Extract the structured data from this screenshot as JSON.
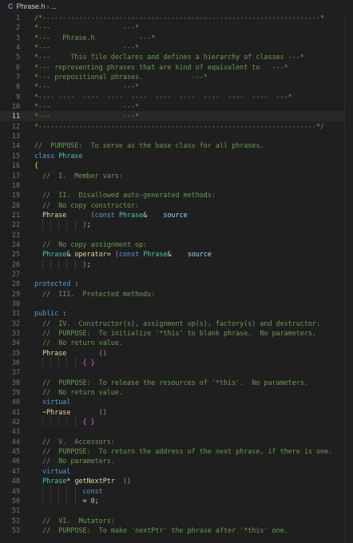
{
  "breadcrumb": {
    "file_icon": "C",
    "file_name": "Phrase.h",
    "separator": "›",
    "more": "..."
  },
  "editor": {
    "current_line": 11,
    "lines": [
      {
        "num": "1",
        "segs": [
          [
            "c",
            "/*---------------------------------------------------------------------*"
          ]
        ]
      },
      {
        "num": "2",
        "segs": [
          [
            "c",
            "*---                  ---*"
          ]
        ]
      },
      {
        "num": "3",
        "segs": [
          [
            "c",
            "*---   Phrase.h           ---*"
          ]
        ]
      },
      {
        "num": "4",
        "segs": [
          [
            "c",
            "*---                  ---*"
          ]
        ]
      },
      {
        "num": "5",
        "segs": [
          [
            "c",
            "*---     This file declares and defines a hierarchy of classes ---*"
          ]
        ]
      },
      {
        "num": "6",
        "segs": [
          [
            "c",
            "*--- representing phrases that are kind of equivalent to   ---*"
          ]
        ]
      },
      {
        "num": "7",
        "segs": [
          [
            "c",
            "*--- prepositional phrases.            ---*"
          ]
        ]
      },
      {
        "num": "8",
        "segs": [
          [
            "c",
            "*---                  ---*"
          ]
        ]
      },
      {
        "num": "9",
        "segs": [
          [
            "c",
            "*---- ----  ----  ----  ----  ----  ----  ----  ----  ----  ---*"
          ]
        ]
      },
      {
        "num": "10",
        "segs": [
          [
            "c",
            "*---                  ---*"
          ]
        ]
      },
      {
        "num": "11",
        "segs": [
          [
            "c",
            "*---                  ---*"
          ]
        ]
      },
      {
        "num": "12",
        "segs": [
          [
            "c",
            "*---------------------------------------------------------------------*/"
          ]
        ]
      },
      {
        "num": "13",
        "segs": []
      },
      {
        "num": "14",
        "segs": [
          [
            "c",
            "//  PURPOSE:  To serve as the base class for all phrases."
          ]
        ]
      },
      {
        "num": "15",
        "segs": [
          [
            "k",
            "class "
          ],
          [
            "t",
            "Phrase"
          ]
        ]
      },
      {
        "num": "16",
        "segs": [
          [
            "b",
            "{"
          ]
        ]
      },
      {
        "num": "17",
        "segs": [
          [
            "w",
            "  "
          ],
          [
            "c",
            "//  I.  Member vars:"
          ]
        ]
      },
      {
        "num": "18",
        "segs": []
      },
      {
        "num": "19",
        "segs": [
          [
            "w",
            "  "
          ],
          [
            "c",
            "//  II.  Disallowed auto-generated methods:"
          ]
        ]
      },
      {
        "num": "20",
        "segs": [
          [
            "w",
            "  "
          ],
          [
            "c",
            "//  No copy constructor:"
          ]
        ]
      },
      {
        "num": "21",
        "segs": [
          [
            "w",
            "  "
          ],
          [
            "y",
            "Phrase"
          ],
          [
            "w",
            "      "
          ],
          [
            "p",
            "("
          ],
          [
            "k",
            "const "
          ],
          [
            "t",
            "Phrase"
          ],
          [
            "w",
            "&    "
          ],
          [
            "v",
            "source"
          ]
        ]
      },
      {
        "num": "22",
        "segs": [
          [
            "w",
            "            "
          ],
          [
            "p",
            ")"
          ],
          [
            "w",
            ";"
          ]
        ]
      },
      {
        "num": "23",
        "segs": []
      },
      {
        "num": "24",
        "segs": [
          [
            "w",
            "  "
          ],
          [
            "c",
            "//  No copy assignment op:"
          ]
        ]
      },
      {
        "num": "25",
        "segs": [
          [
            "w",
            "  "
          ],
          [
            "t",
            "Phrase"
          ],
          [
            "w",
            "& "
          ],
          [
            "y",
            "operator="
          ],
          [
            "w",
            " "
          ],
          [
            "p",
            "("
          ],
          [
            "k",
            "const "
          ],
          [
            "t",
            "Phrase"
          ],
          [
            "w",
            "&    "
          ],
          [
            "v",
            "source"
          ]
        ]
      },
      {
        "num": "26",
        "segs": [
          [
            "w",
            "            "
          ],
          [
            "p",
            ")"
          ],
          [
            "w",
            ";"
          ]
        ]
      },
      {
        "num": "27",
        "segs": []
      },
      {
        "num": "28",
        "segs": [
          [
            "k",
            "protected"
          ],
          [
            "w",
            " :"
          ]
        ]
      },
      {
        "num": "29",
        "segs": [
          [
            "w",
            "  "
          ],
          [
            "c",
            "//  III.  Protected methods:"
          ]
        ]
      },
      {
        "num": "30",
        "segs": []
      },
      {
        "num": "31",
        "segs": [
          [
            "k",
            "public"
          ],
          [
            "w",
            " :"
          ]
        ]
      },
      {
        "num": "32",
        "segs": [
          [
            "w",
            "  "
          ],
          [
            "c",
            "//  IV.  Constructor(s), assignment op(s), factory(s) and destructor:"
          ]
        ]
      },
      {
        "num": "33",
        "segs": [
          [
            "w",
            "  "
          ],
          [
            "c",
            "//  PURPOSE:  To initialize '*this' to blank phrase.  No parameters."
          ]
        ]
      },
      {
        "num": "34",
        "segs": [
          [
            "w",
            "  "
          ],
          [
            "c",
            "//  No return value."
          ]
        ]
      },
      {
        "num": "35",
        "segs": [
          [
            "w",
            "  "
          ],
          [
            "y",
            "Phrase"
          ],
          [
            "w",
            "        "
          ],
          [
            "p",
            "()"
          ]
        ]
      },
      {
        "num": "36",
        "segs": [
          [
            "w",
            "            "
          ],
          [
            "p",
            "{ }"
          ]
        ]
      },
      {
        "num": "37",
        "segs": []
      },
      {
        "num": "38",
        "segs": [
          [
            "w",
            "  "
          ],
          [
            "c",
            "//  PURPOSE:  To release the resources of '*this'.  No parameters."
          ]
        ]
      },
      {
        "num": "39",
        "segs": [
          [
            "w",
            "  "
          ],
          [
            "c",
            "//  No return value."
          ]
        ]
      },
      {
        "num": "40",
        "segs": [
          [
            "w",
            "  "
          ],
          [
            "k",
            "virtual"
          ]
        ]
      },
      {
        "num": "41",
        "segs": [
          [
            "w",
            "  "
          ],
          [
            "y",
            "~Phrase"
          ],
          [
            "w",
            "       "
          ],
          [
            "p",
            "()"
          ]
        ]
      },
      {
        "num": "42",
        "segs": [
          [
            "w",
            "            "
          ],
          [
            "p",
            "{ }"
          ]
        ]
      },
      {
        "num": "43",
        "segs": []
      },
      {
        "num": "44",
        "segs": [
          [
            "w",
            "  "
          ],
          [
            "c",
            "//  V.  Accessors:"
          ]
        ]
      },
      {
        "num": "45",
        "segs": [
          [
            "w",
            "  "
          ],
          [
            "c",
            "//  PURPOSE:  To return the address of the next phrase, if there is one."
          ]
        ]
      },
      {
        "num": "46",
        "segs": [
          [
            "w",
            "  "
          ],
          [
            "c",
            "//  No parameters."
          ]
        ]
      },
      {
        "num": "47",
        "segs": [
          [
            "w",
            "  "
          ],
          [
            "k",
            "virtual"
          ]
        ]
      },
      {
        "num": "48",
        "segs": [
          [
            "w",
            "  "
          ],
          [
            "t",
            "Phrase"
          ],
          [
            "w",
            "* "
          ],
          [
            "y",
            "getNextPtr"
          ],
          [
            "w",
            "  "
          ],
          [
            "p",
            "()"
          ]
        ]
      },
      {
        "num": "49",
        "segs": [
          [
            "w",
            "            "
          ],
          [
            "k",
            "const"
          ]
        ]
      },
      {
        "num": "50",
        "segs": [
          [
            "w",
            "            = "
          ],
          [
            "n",
            "0"
          ],
          [
            "w",
            ";"
          ]
        ]
      },
      {
        "num": "51",
        "segs": []
      },
      {
        "num": "52",
        "segs": [
          [
            "w",
            "  "
          ],
          [
            "c",
            "//  VI.  Mutators:"
          ]
        ]
      },
      {
        "num": "53",
        "segs": [
          [
            "w",
            "  "
          ],
          [
            "c",
            "//  PURPOSE:  To make 'nextPtr' the phrase after '*this' one."
          ]
        ]
      }
    ]
  }
}
